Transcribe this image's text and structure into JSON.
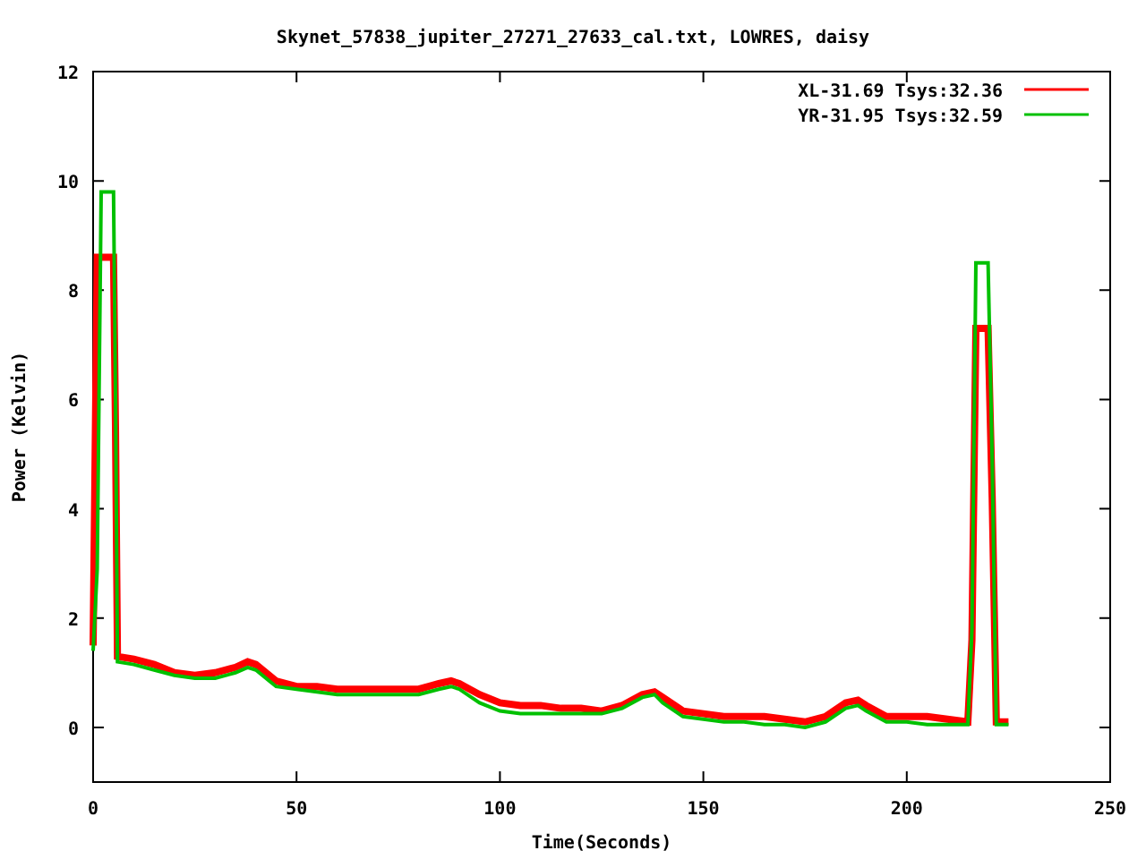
{
  "chart_data": {
    "type": "line",
    "title": "Skynet_57838_jupiter_27271_27633_cal.txt, LOWRES, daisy",
    "xlabel": "Time(Seconds)",
    "ylabel": "Power (Kelvin)",
    "xlim": [
      0,
      250
    ],
    "ylim": [
      -1,
      12
    ],
    "legend": true,
    "xticks": [
      0,
      50,
      100,
      150,
      200,
      250
    ],
    "yticks": [
      0,
      2,
      4,
      6,
      8,
      10,
      12
    ],
    "x": [
      0,
      1,
      2,
      3,
      4,
      5,
      5.5,
      6,
      10,
      15,
      20,
      25,
      30,
      35,
      38,
      40,
      45,
      50,
      55,
      60,
      65,
      70,
      75,
      80,
      85,
      88,
      90,
      95,
      100,
      105,
      110,
      115,
      120,
      125,
      130,
      135,
      138,
      140,
      145,
      150,
      155,
      160,
      165,
      170,
      175,
      180,
      185,
      188,
      190,
      195,
      200,
      205,
      210,
      215,
      216,
      217,
      218,
      219,
      220,
      221,
      222,
      225
    ],
    "series": [
      {
        "name": "XL-31.69 Tsys:32.36",
        "color": "#ff0000",
        "values": [
          1.5,
          8.6,
          8.6,
          8.6,
          8.6,
          8.6,
          5.5,
          1.3,
          1.25,
          1.15,
          1.0,
          0.95,
          1.0,
          1.1,
          1.2,
          1.15,
          0.85,
          0.75,
          0.75,
          0.7,
          0.7,
          0.7,
          0.7,
          0.7,
          0.8,
          0.85,
          0.8,
          0.6,
          0.45,
          0.4,
          0.4,
          0.35,
          0.35,
          0.3,
          0.4,
          0.6,
          0.65,
          0.55,
          0.3,
          0.25,
          0.2,
          0.2,
          0.2,
          0.15,
          0.1,
          0.2,
          0.45,
          0.5,
          0.4,
          0.2,
          0.2,
          0.2,
          0.15,
          0.1,
          1.6,
          7.3,
          7.3,
          7.3,
          7.3,
          4.2,
          0.1,
          0.1
        ]
      },
      {
        "name": "YR-31.95 Tsys:32.59",
        "color": "#00c000",
        "values": [
          1.4,
          2.9,
          9.8,
          9.8,
          9.8,
          9.8,
          6.1,
          1.2,
          1.15,
          1.05,
          0.95,
          0.9,
          0.9,
          1.0,
          1.1,
          1.05,
          0.75,
          0.7,
          0.65,
          0.6,
          0.6,
          0.6,
          0.6,
          0.6,
          0.7,
          0.75,
          0.7,
          0.45,
          0.3,
          0.25,
          0.25,
          0.25,
          0.25,
          0.25,
          0.35,
          0.55,
          0.6,
          0.45,
          0.2,
          0.15,
          0.1,
          0.1,
          0.05,
          0.05,
          0.0,
          0.1,
          0.35,
          0.4,
          0.3,
          0.1,
          0.1,
          0.05,
          0.05,
          0.05,
          1.8,
          8.5,
          8.5,
          8.5,
          8.5,
          4.9,
          0.05,
          0.05
        ]
      }
    ]
  }
}
